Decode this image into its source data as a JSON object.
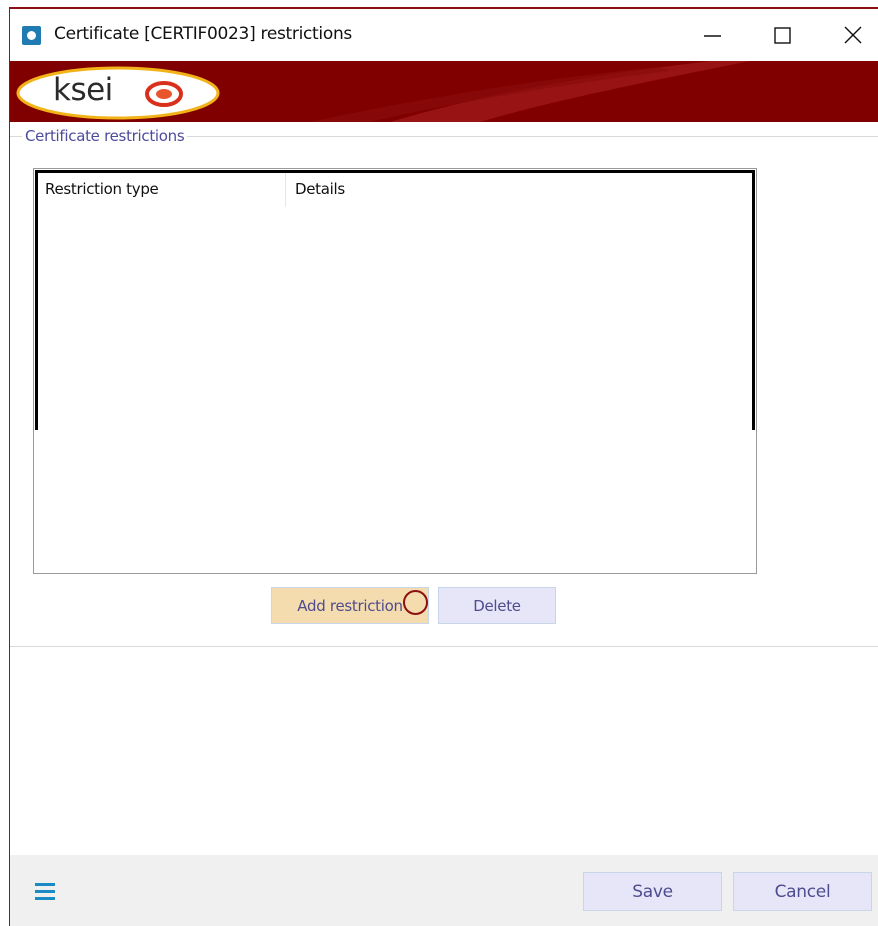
{
  "window": {
    "title": "Certificate [CERTIF0023] restrictions",
    "controls": [
      "minimize",
      "maximize",
      "close"
    ]
  },
  "banner": {
    "logo_text": "ksei",
    "background_color": "#800000"
  },
  "group": {
    "legend": "Certificate restrictions"
  },
  "list": {
    "columns": [
      "Restriction type",
      "Details"
    ],
    "rows": []
  },
  "actions": {
    "add_label": "Add restriction",
    "delete_label": "Delete"
  },
  "footer": {
    "menu_icon": "hamburger-menu-icon",
    "save_label": "Save",
    "cancel_label": "Cancel"
  },
  "colors": {
    "accent_text": "#4f4b8f",
    "hover_button": "#f5dcae",
    "button_bg": "#e6e6f8",
    "menu_icon": "#1a8bc5"
  }
}
